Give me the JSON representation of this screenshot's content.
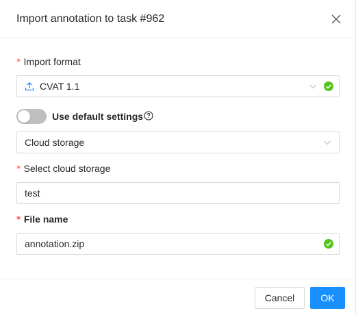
{
  "modal": {
    "title": "Import annotation to task #962"
  },
  "import_format": {
    "required_mark": "*",
    "label": "Import format",
    "value": "CVAT 1.1"
  },
  "use_default_settings": {
    "label": "Use default settings",
    "enabled": false
  },
  "source_select": {
    "value": "Cloud storage"
  },
  "cloud_storage": {
    "required_mark": "*",
    "label": "Select cloud storage",
    "value": "test"
  },
  "file_name": {
    "required_mark": "*",
    "label": "File name",
    "value": "annotation.zip"
  },
  "footer": {
    "cancel_label": "Cancel",
    "ok_label": "OK"
  },
  "colors": {
    "primary": "#1890ff",
    "success": "#52c41a",
    "required": "#ff4d4f",
    "switch_off": "#bfbfbf"
  },
  "icons": {
    "close": "close-icon",
    "upload": "upload-icon",
    "chevron": "chevron-down-icon",
    "check": "check-circle-icon",
    "help": "question-circle-icon"
  }
}
